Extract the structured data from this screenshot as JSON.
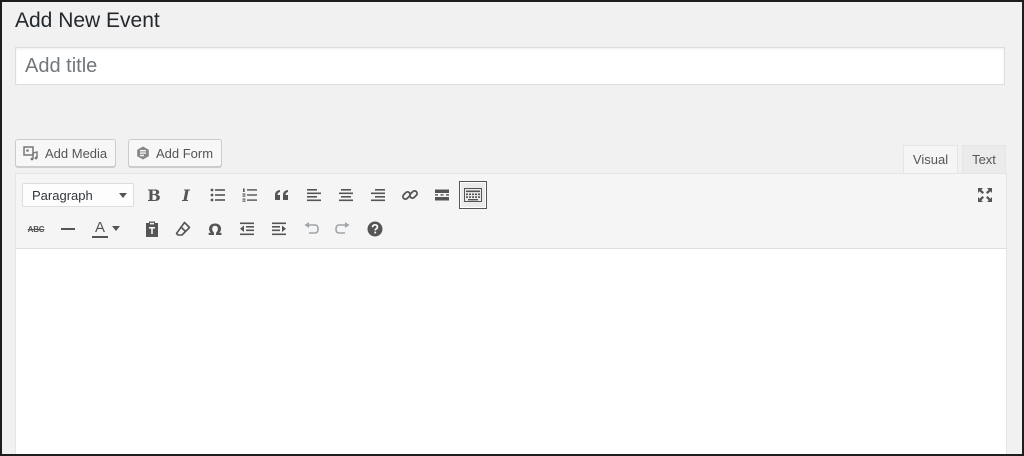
{
  "page": {
    "title": "Add New Event"
  },
  "title_field": {
    "placeholder": "Add title",
    "value": ""
  },
  "media_buttons": [
    {
      "label": "Add Media",
      "icon": "media-icon"
    },
    {
      "label": "Add Form",
      "icon": "form-icon"
    }
  ],
  "editor_tabs": [
    {
      "label": "Visual",
      "active": true
    },
    {
      "label": "Text",
      "active": false
    }
  ],
  "toolbar": {
    "format_select": {
      "selected": "Paragraph"
    },
    "row1": [
      "bold-icon",
      "italic-icon",
      "bulleted-list-icon",
      "numbered-list-icon",
      "blockquote-icon",
      "align-left-icon",
      "align-center-icon",
      "align-right-icon",
      "link-icon",
      "read-more-icon",
      "toolbar-toggle-icon"
    ],
    "row2": [
      "strikethrough-icon",
      "horizontal-line-icon",
      "text-color-icon",
      "paste-as-text-icon",
      "clear-formatting-icon",
      "special-character-icon",
      "outdent-icon",
      "indent-icon",
      "undo-icon",
      "redo-icon",
      "help-icon"
    ],
    "fullscreen_icon": "fullscreen-icon",
    "labels": {
      "bold": "B",
      "italic": "I",
      "strikethrough": "ABC",
      "text_color": "A",
      "omega": "Ω"
    }
  },
  "colors": {
    "background": "#f1f1f1",
    "toolbar": "#f5f5f5",
    "icon": "#555555",
    "disabled_icon": "#a0a5aa"
  }
}
